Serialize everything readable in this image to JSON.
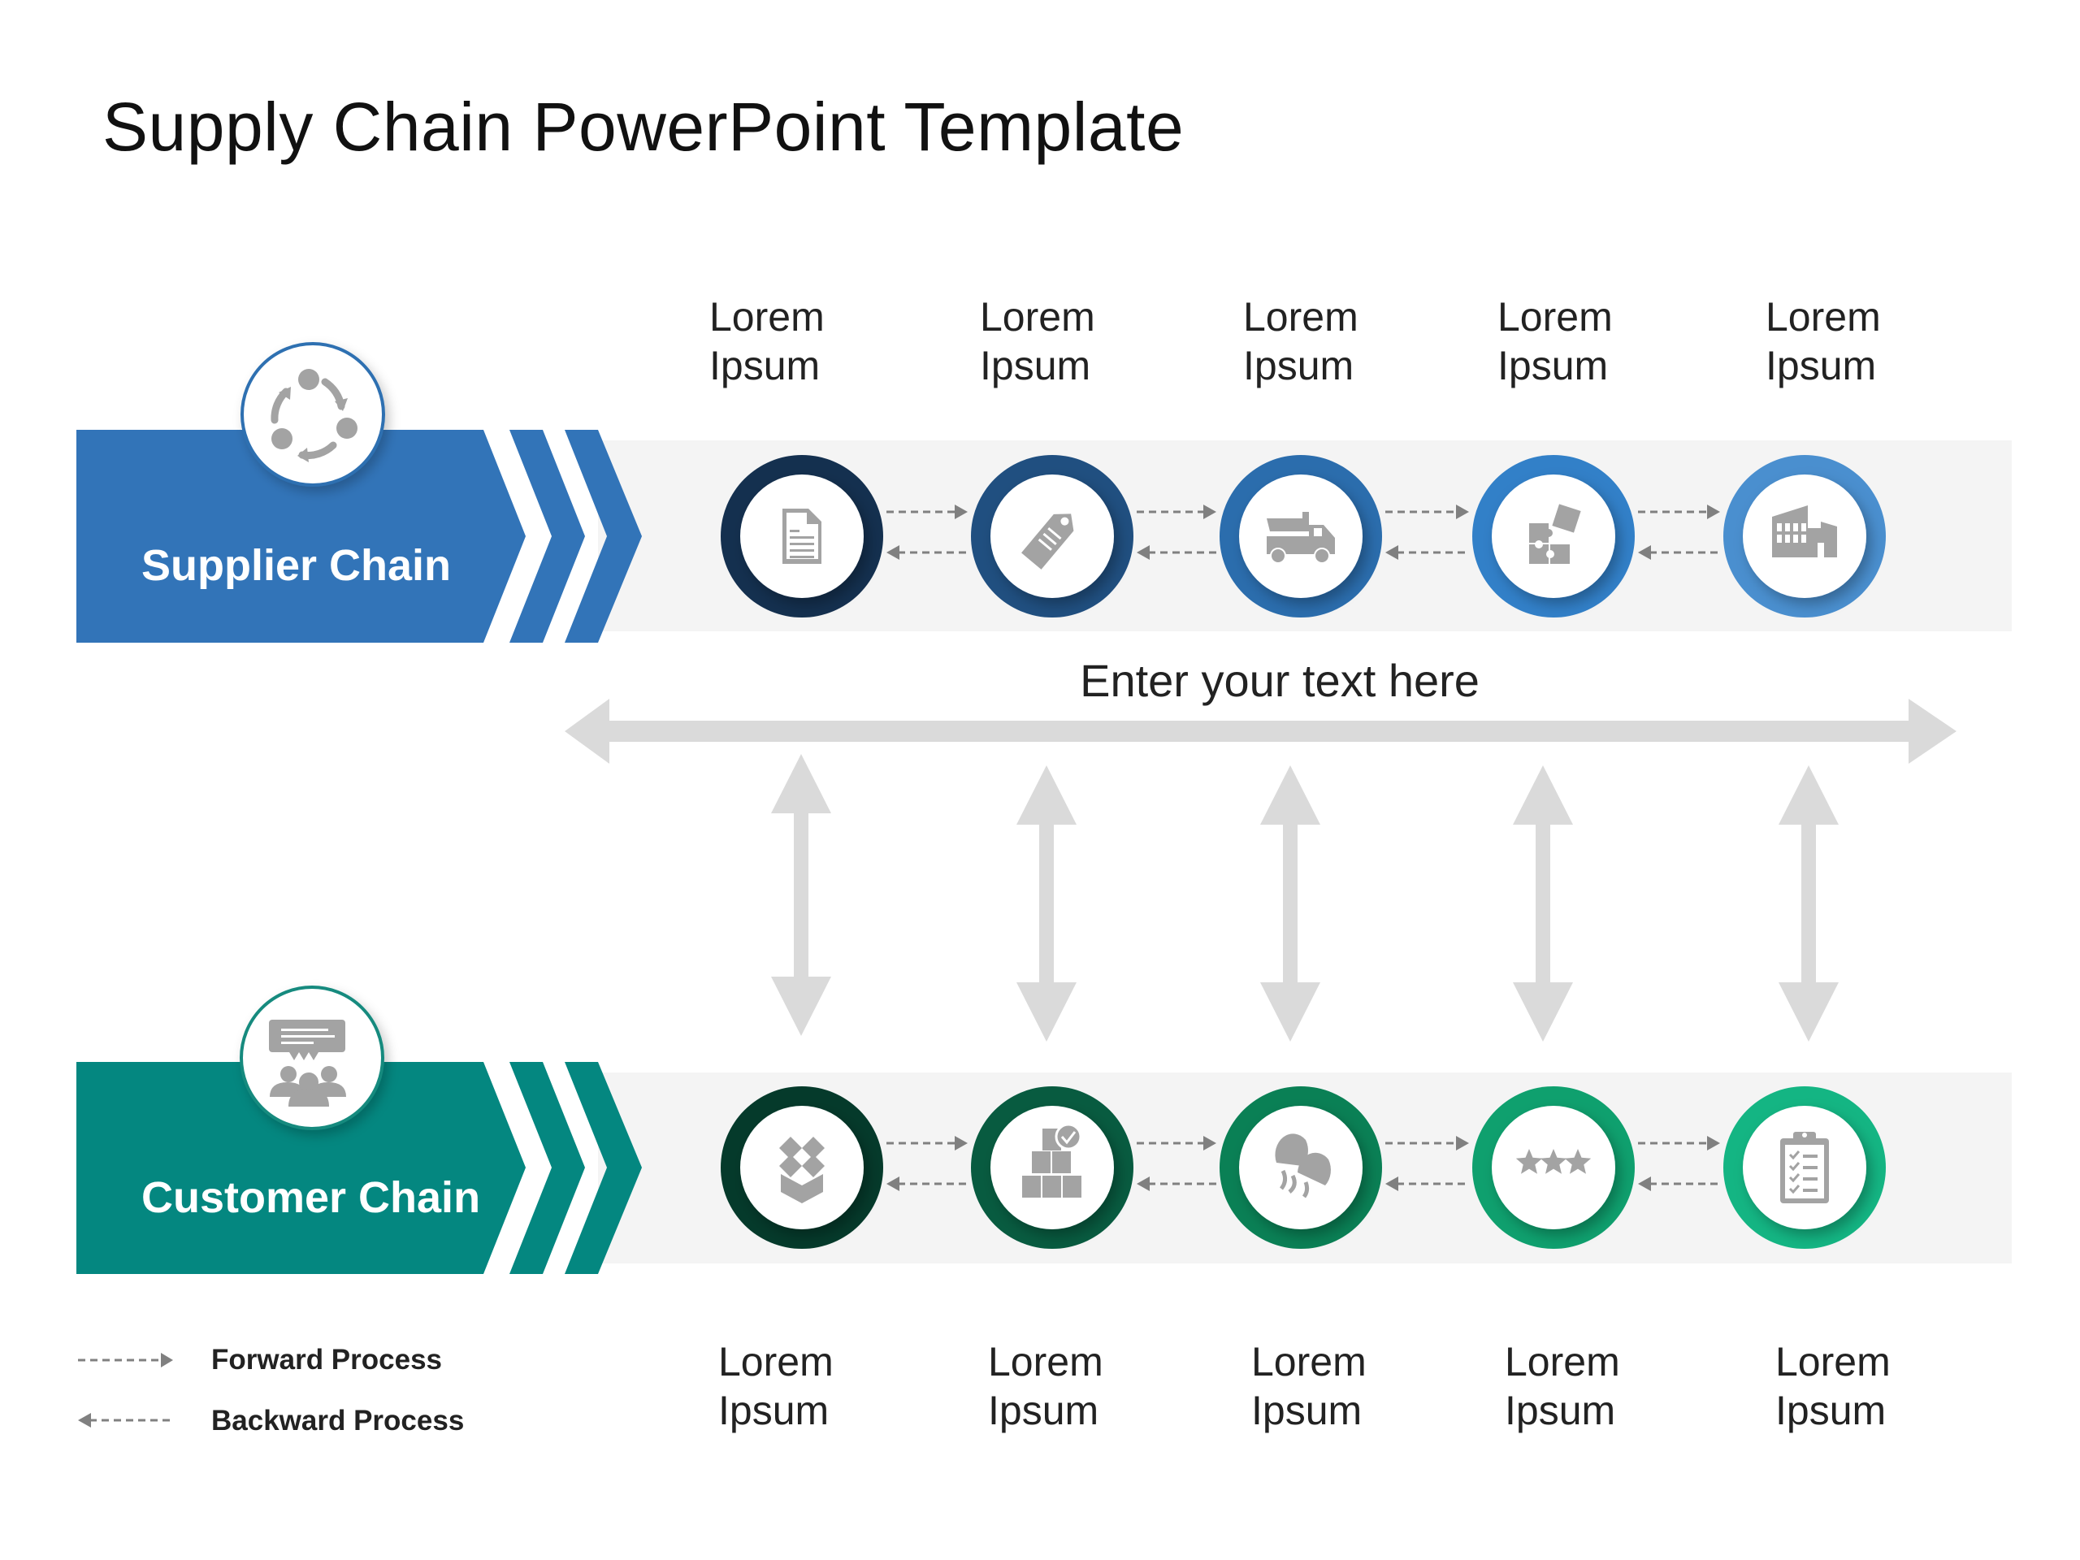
{
  "title": "Supply Chain PowerPoint Template",
  "colors": {
    "supplier_band": "#3274b8",
    "customer_band": "#048780",
    "track_gray": "#f3f3f3",
    "arrow_gray": "#dadada",
    "dash_gray": "#808080",
    "icon_gray": "#a3a3a3",
    "supplier_rings": [
      "#14304f",
      "#204f80",
      "#2b6dad",
      "#3280c8",
      "#4a8fcf"
    ],
    "customer_rings": [
      "#053a2b",
      "#085b40",
      "#0a8055",
      "#0fa06e",
      "#14b583"
    ]
  },
  "supplier_chain": {
    "label": "Supplier Chain",
    "badge_icon": "cycle-icon",
    "steps": [
      {
        "title": "Lorem\nIpsum",
        "icon": "document-icon"
      },
      {
        "title": "Lorem\nIpsum",
        "icon": "price-tag-icon"
      },
      {
        "title": "Lorem\nIpsum",
        "icon": "dump-truck-icon"
      },
      {
        "title": "Lorem\nIpsum",
        "icon": "puzzle-icon"
      },
      {
        "title": "Lorem\nIpsum",
        "icon": "factory-icon"
      }
    ]
  },
  "middle_text": "Enter your text here",
  "customer_chain": {
    "label": "Customer Chain",
    "badge_icon": "customer-feedback-icon",
    "steps": [
      {
        "title": "Lorem\nIpsum",
        "icon": "open-box-icon"
      },
      {
        "title": "Lorem\nIpsum",
        "icon": "stacked-boxes-check-icon"
      },
      {
        "title": "Lorem\nIpsum",
        "icon": "ice-cream-icon"
      },
      {
        "title": "Lorem\nIpsum",
        "icon": "three-stars-icon"
      },
      {
        "title": "Lorem\nIpsum",
        "icon": "checklist-clipboard-icon"
      }
    ]
  },
  "legend": {
    "forward": "Forward Process",
    "backward": "Backward Process"
  }
}
